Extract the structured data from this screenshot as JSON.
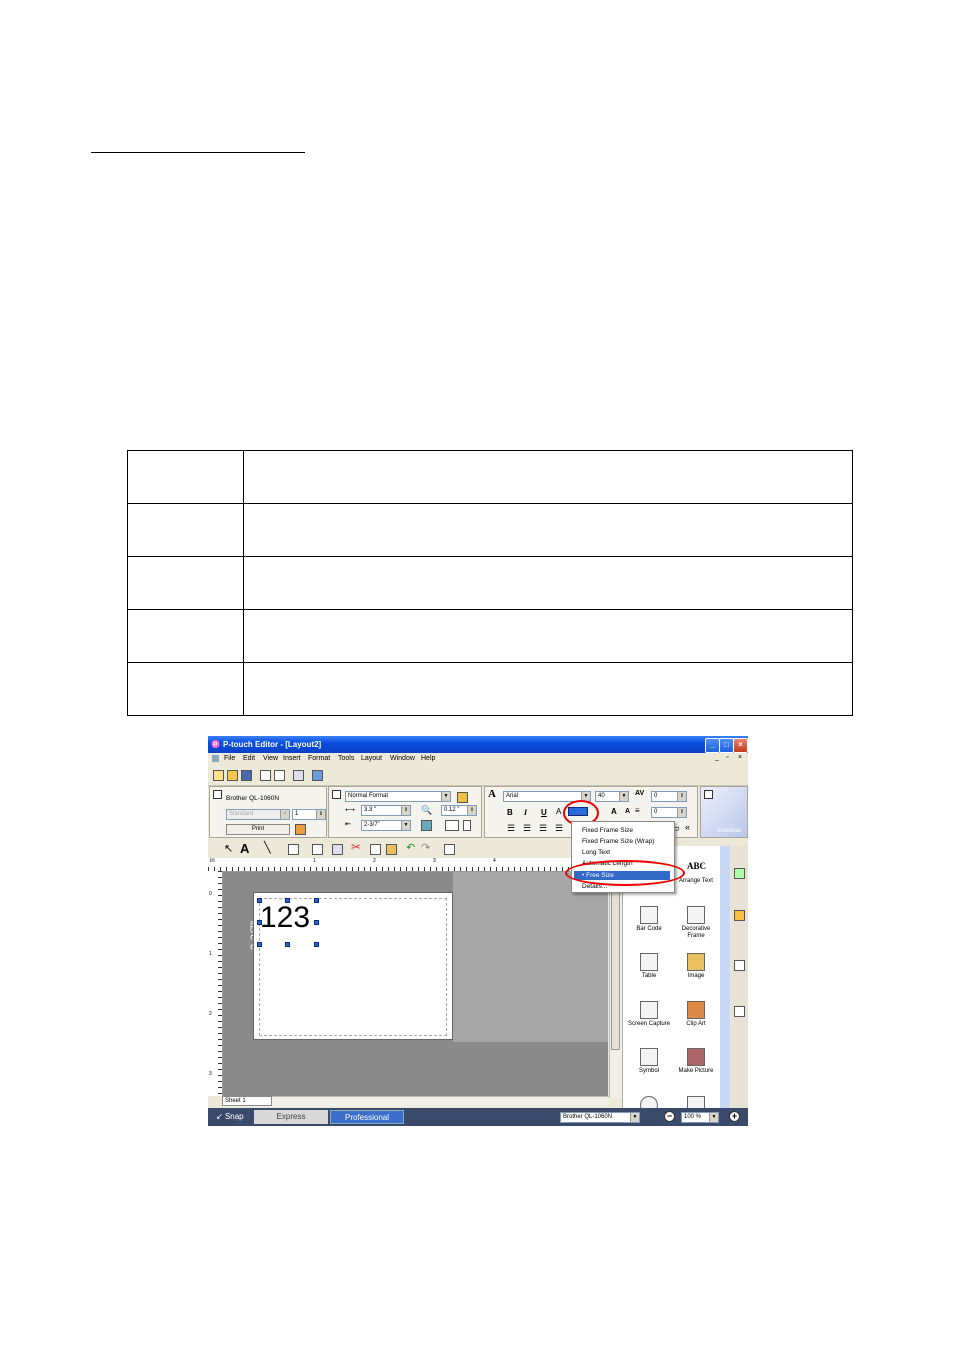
{
  "window": {
    "title": "P-touch Editor - [Layout2]"
  },
  "menu": [
    "File",
    "Edit",
    "View",
    "Insert",
    "Format",
    "Tools",
    "Layout",
    "Window",
    "Help"
  ],
  "printer_panel": {
    "printer": "Brother QL-1060N",
    "quality": "Standard",
    "copies": "1",
    "print_label": "Print"
  },
  "paper_panel": {
    "format": "Normal Format",
    "width": "3.3 \"",
    "margin": "0.12 \"",
    "length": "2-3/7\""
  },
  "font_panel": {
    "font": "Arial",
    "size": "40",
    "spacing": "0",
    "line_spacing": "0",
    "bold": "B",
    "italic": "I",
    "underline": "U"
  },
  "extra_panel": {
    "text": "essional"
  },
  "dropdown": {
    "items": [
      "Fixed Frame Size",
      "Fixed Frame Size (Wrap)",
      "Long Text",
      "Automatic Length",
      "Free Size",
      "Details..."
    ],
    "selected": "Free Size"
  },
  "ruler": {
    "unit": "in",
    "marks": [
      "1",
      "2",
      "3",
      "4"
    ],
    "vmarks": [
      "0",
      "1",
      "2",
      "3"
    ]
  },
  "canvas": {
    "label_text": "123",
    "vertical_dimension": "2-3/7\"",
    "sheet_tab": "Sheet 1"
  },
  "side_panel": {
    "objects": [
      "Arrange Text",
      "Bar Code",
      "Decorative Frame",
      "Table",
      "Image",
      "Screen Capture",
      "Clip Art",
      "Symbol",
      "Make Picture"
    ],
    "arrange_icon_text": "ABC"
  },
  "statusbar": {
    "snap": "Snap",
    "express": "Express",
    "professional": "Professional",
    "printer": "Brother QL-1060N",
    "zoom": "100 %"
  }
}
